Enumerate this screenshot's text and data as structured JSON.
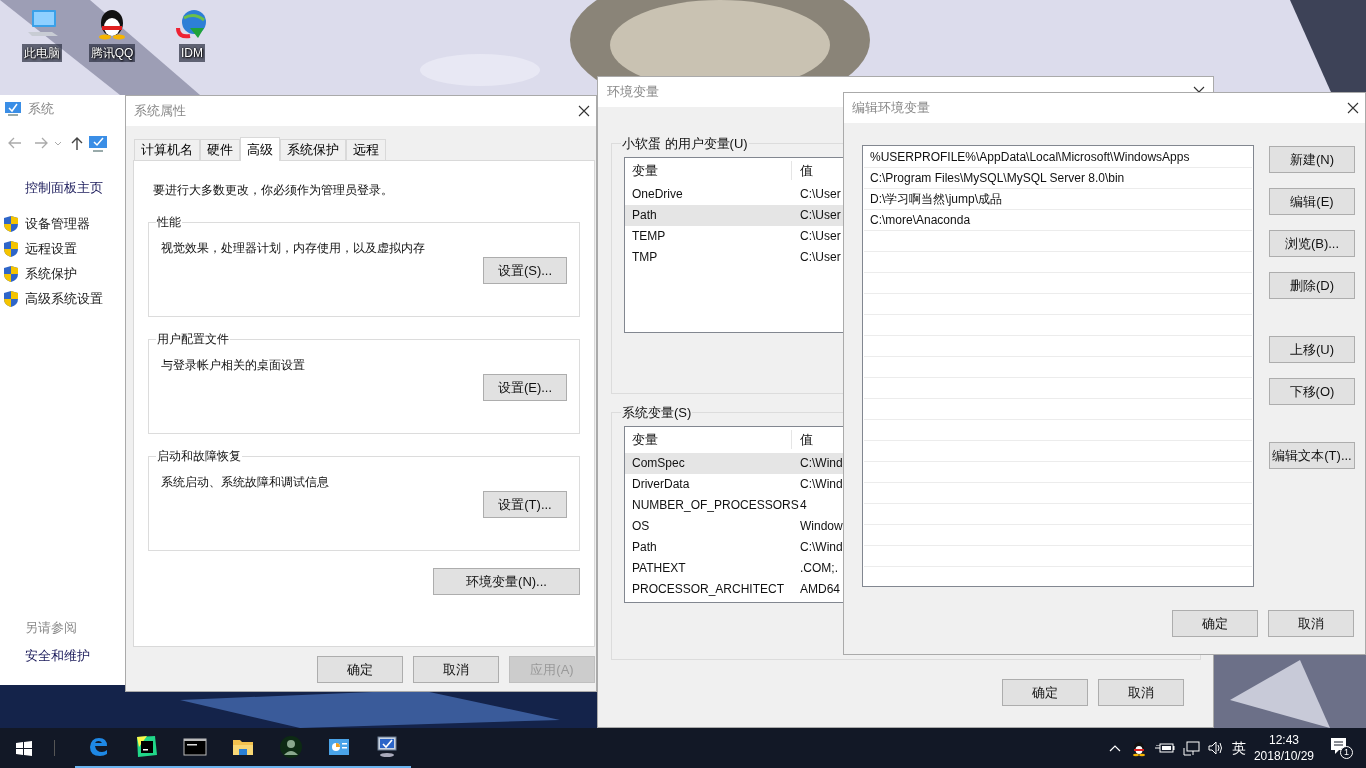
{
  "desktop": {
    "icons": [
      {
        "label": "此电脑",
        "kind": "computer"
      },
      {
        "label": "腾讯QQ",
        "kind": "qq"
      },
      {
        "label": "IDM",
        "kind": "idm"
      }
    ]
  },
  "system_window": {
    "title": "系统",
    "home_link": "控制面板主页",
    "tasks": [
      {
        "label": "设备管理器"
      },
      {
        "label": "远程设置"
      },
      {
        "label": "系统保护"
      },
      {
        "label": "高级系统设置"
      }
    ],
    "see_also_heading": "另请参阅",
    "see_also": [
      {
        "label": "安全和维护"
      }
    ]
  },
  "system_properties": {
    "title": "系统属性",
    "tabs": [
      {
        "label": "计算机名",
        "selected": false
      },
      {
        "label": "硬件",
        "selected": false
      },
      {
        "label": "高级",
        "selected": true
      },
      {
        "label": "系统保护",
        "selected": false
      },
      {
        "label": "远程",
        "selected": false
      }
    ],
    "notice": "要进行大多数更改，你必须作为管理员登录。",
    "groups": [
      {
        "title": "性能",
        "description": "视觉效果，处理器计划，内存使用，以及虚拟内存",
        "button": "设置(S)..."
      },
      {
        "title": "用户配置文件",
        "description": "与登录帐户相关的桌面设置",
        "button": "设置(E)..."
      },
      {
        "title": "启动和故障恢复",
        "description": "系统启动、系统故障和调试信息",
        "button": "设置(T)..."
      }
    ],
    "env_button": "环境变量(N)...",
    "buttons": [
      {
        "label": "确定",
        "disabled": false
      },
      {
        "label": "取消",
        "disabled": false
      },
      {
        "label": "应用(A)",
        "disabled": true
      }
    ]
  },
  "env_vars": {
    "title": "环境变量",
    "user_group": "小软蛋 的用户变量(U)",
    "user_table": {
      "columns": [
        "变量",
        "值"
      ],
      "rows": [
        {
          "name": "OneDrive",
          "value": "C:\\User",
          "selected": false
        },
        {
          "name": "Path",
          "value": "C:\\User",
          "selected": true
        },
        {
          "name": "TEMP",
          "value": "C:\\User",
          "selected": false
        },
        {
          "name": "TMP",
          "value": "C:\\User",
          "selected": false
        }
      ]
    },
    "system_group": "系统变量(S)",
    "system_table": {
      "columns": [
        "变量",
        "值"
      ],
      "rows": [
        {
          "name": "ComSpec",
          "value": "C:\\Wind",
          "selected": true
        },
        {
          "name": "DriverData",
          "value": "C:\\Wind",
          "selected": false
        },
        {
          "name": "NUMBER_OF_PROCESSORS",
          "value": "4",
          "selected": false
        },
        {
          "name": "OS",
          "value": "Window",
          "selected": false
        },
        {
          "name": "Path",
          "value": "C:\\Wind",
          "selected": false
        },
        {
          "name": "PATHEXT",
          "value": ".COM;.",
          "selected": false
        },
        {
          "name": "PROCESSOR_ARCHITECT",
          "value": "AMD64",
          "selected": false
        }
      ]
    },
    "buttons": [
      "确定",
      "取消"
    ]
  },
  "edit_env": {
    "title": "编辑环境变量",
    "entries": [
      "%USERPROFILE%\\AppData\\Local\\Microsoft\\WindowsApps",
      "C:\\Program Files\\MySQL\\MySQL Server 8.0\\bin",
      "D:\\学习啊当然\\jump\\成品",
      "C:\\more\\Anaconda"
    ],
    "side_button_groups": [
      [
        "新建(N)",
        "编辑(E)",
        "浏览(B)...",
        "删除(D)"
      ],
      [
        "上移(U)",
        "下移(O)"
      ],
      [
        "编辑文本(T)..."
      ]
    ],
    "buttons": [
      "确定",
      "取消"
    ]
  },
  "taskbar": {
    "apps": [
      {
        "kind": "edge"
      },
      {
        "kind": "pycharm"
      },
      {
        "kind": "terminal"
      },
      {
        "kind": "folder"
      },
      {
        "kind": "avatar"
      },
      {
        "kind": "control-panel"
      },
      {
        "kind": "system"
      }
    ],
    "ime": "英",
    "time": "12:43",
    "date": "2018/10/29",
    "notification_count": "1"
  }
}
